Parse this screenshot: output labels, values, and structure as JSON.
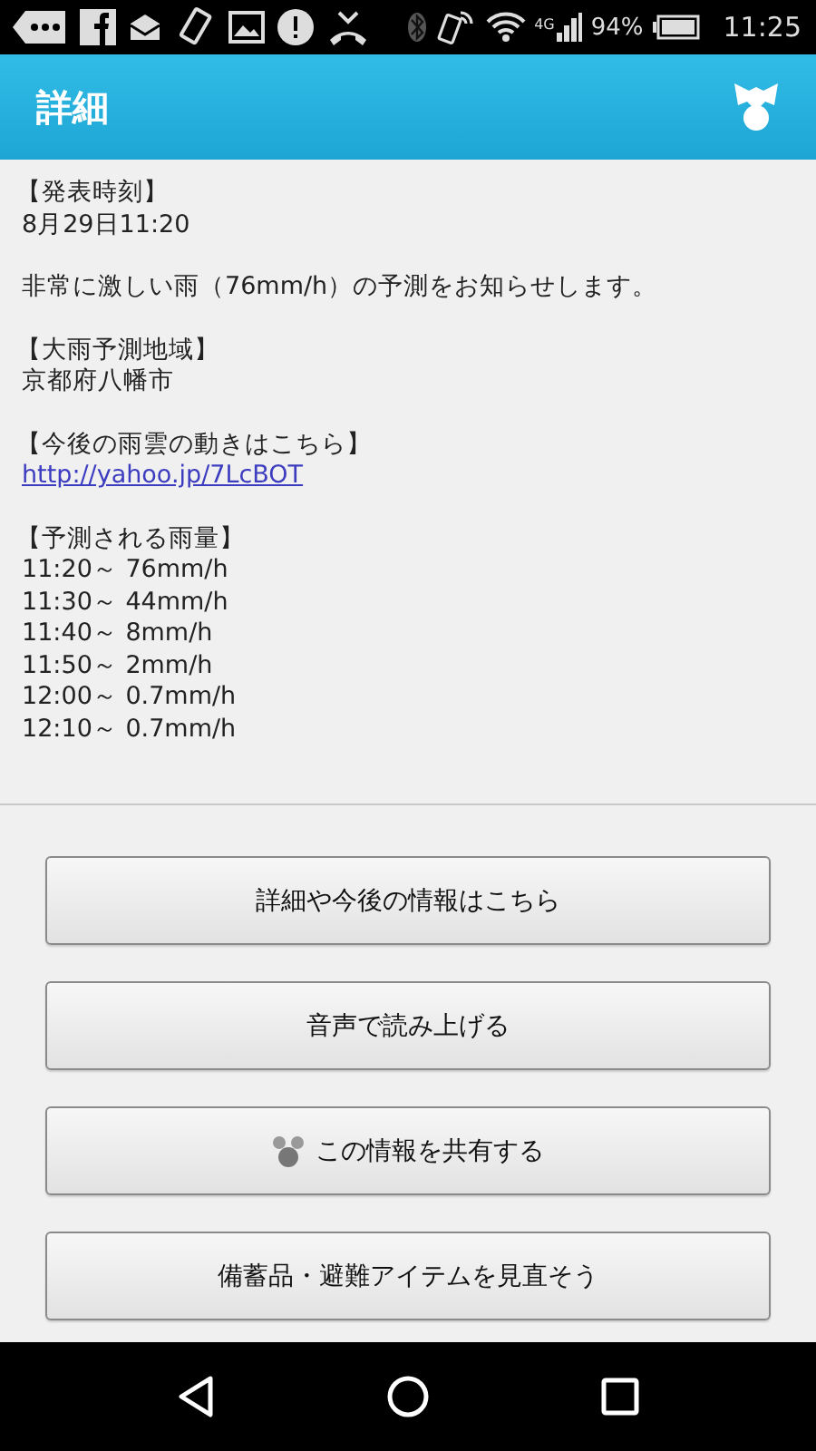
{
  "status_bar": {
    "network": "4G",
    "battery": "94%",
    "time": "11:25"
  },
  "header": {
    "title": "詳細"
  },
  "message": {
    "sections": [
      {
        "lines": [
          {
            "kind": "heading",
            "text": "【発表時刻】"
          },
          {
            "kind": "text",
            "text": "8月29日11:20"
          }
        ]
      },
      {
        "lines": [
          {
            "kind": "text",
            "text": "非常に激しい雨（76mm/h）の予測をお知らせします。"
          }
        ]
      },
      {
        "lines": [
          {
            "kind": "heading",
            "text": "【大雨予測地域】"
          },
          {
            "kind": "text",
            "text": "京都府八幡市"
          }
        ]
      },
      {
        "lines": [
          {
            "kind": "heading",
            "text": "【今後の雨雲の動きはこちら】"
          },
          {
            "kind": "link",
            "text": "http://yahoo.jp/7LcBOT"
          }
        ]
      },
      {
        "lines": [
          {
            "kind": "heading",
            "text": "【予測される雨量】"
          },
          {
            "kind": "text",
            "text": "11:20～ 76mm/h"
          },
          {
            "kind": "text",
            "text": "11:30～ 44mm/h"
          },
          {
            "kind": "text",
            "text": "11:40～ 8mm/h"
          },
          {
            "kind": "text",
            "text": "11:50～ 2mm/h"
          },
          {
            "kind": "text",
            "text": "12:00～ 0.7mm/h"
          },
          {
            "kind": "text",
            "text": "12:10～ 0.7mm/h"
          }
        ]
      }
    ]
  },
  "buttons": [
    {
      "label": "詳細や今後の情報はこちら",
      "icon": false
    },
    {
      "label": "音声で読み上げる",
      "icon": false
    },
    {
      "label": "この情報を共有する",
      "icon": true
    },
    {
      "label": "備蓄品・避難アイテムを見直そう",
      "icon": false
    }
  ]
}
